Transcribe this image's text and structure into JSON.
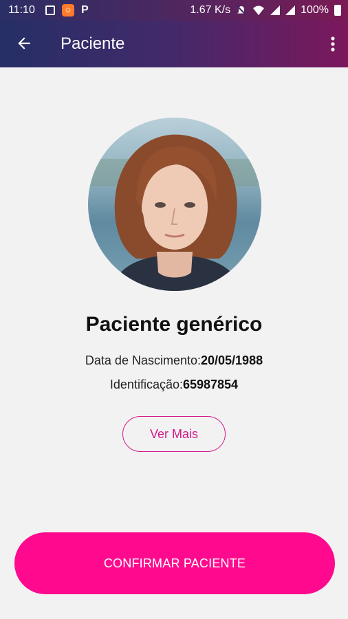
{
  "status_bar": {
    "time": "11:10",
    "speed": "1.67 K/s",
    "battery": "100%",
    "icons": [
      "image-icon",
      "app-notification-icon",
      "p-icon",
      "mute-icon",
      "wifi-icon",
      "signal-icon",
      "battery-icon"
    ]
  },
  "app_bar": {
    "title": "Paciente",
    "back_icon": "arrow-left-icon",
    "menu_icon": "more-vert-icon"
  },
  "patient": {
    "name": "Paciente genérico",
    "birth_label": "Data de Nascimento:",
    "birth_value": "20/05/1988",
    "id_label": "Identificação:",
    "id_value": "65987854"
  },
  "actions": {
    "ver_mais": "Ver Mais",
    "confirm": "CONFIRMAR PACIENTE"
  },
  "colors": {
    "accent": "#ff0a8e",
    "outline": "#d21a8a",
    "appbar_start": "#252f66",
    "appbar_end": "#7c175c"
  }
}
